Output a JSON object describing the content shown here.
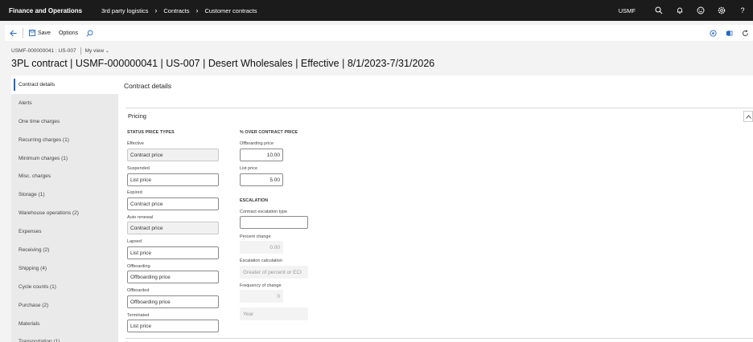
{
  "appbar": {
    "title": "Finance and Operations",
    "breadcrumbs": [
      "3rd party logistics",
      "Contracts",
      "Customer contracts"
    ],
    "company": "USMF",
    "icons": [
      "search-icon",
      "bell-icon",
      "smiley-icon",
      "gear-icon",
      "help-icon"
    ]
  },
  "actionpane": {
    "save_label": "Save",
    "options_label": "Options"
  },
  "header": {
    "record_id": "USMF-000000041 : US-007",
    "view_label": "My view",
    "title": "3PL contract | USMF-000000041 | US-007 | Desert Wholesales | Effective | 8/1/2023-7/31/2026"
  },
  "nav": {
    "items": [
      "Contract details",
      "Alerts",
      "One time charges",
      "Recurring charges (1)",
      "Minimum charges (1)",
      "Misc. charges",
      "Storage (1)",
      "Warehouse operations (2)",
      "Expenses",
      "Receiving (2)",
      "Shipping (4)",
      "Cycle counts (1)",
      "Purchase (2)",
      "Materials",
      "Transportation (1)"
    ]
  },
  "content": {
    "title": "Contract details",
    "fasttab_label": "Pricing",
    "status_heading": "STATUS PRICE TYPES",
    "status_fields": [
      {
        "label": "Effective",
        "value": "Contract price"
      },
      {
        "label": "Suspended",
        "value": "List price"
      },
      {
        "label": "Expired",
        "value": "Contract price"
      },
      {
        "label": "Auto renewal",
        "value": "Contract price"
      },
      {
        "label": "Lapsed",
        "value": "List price"
      },
      {
        "label": "Offboarding",
        "value": "Offboarding price"
      },
      {
        "label": "Offboarded",
        "value": "Offboarding price"
      },
      {
        "label": "Terminated",
        "value": "List price"
      }
    ],
    "pct_heading": "% OVER CONTRACT PRICE",
    "offboarding_price": {
      "label": "Offboarding price",
      "value": "10.00"
    },
    "list_price": {
      "label": "List price",
      "value": "5.00"
    },
    "escalation_heading": "ESCALATION",
    "escalation_type": {
      "label": "Contract escalation type",
      "value": ""
    },
    "percent_change": {
      "label": "Percent change",
      "value": "0.00"
    },
    "escalation_calc": {
      "label": "Escalation calculation",
      "value": "Greater of percent or ECI"
    },
    "frequency": {
      "label": "Frequency of change",
      "value": "0"
    },
    "frequency_unit": {
      "value": "Year"
    }
  }
}
